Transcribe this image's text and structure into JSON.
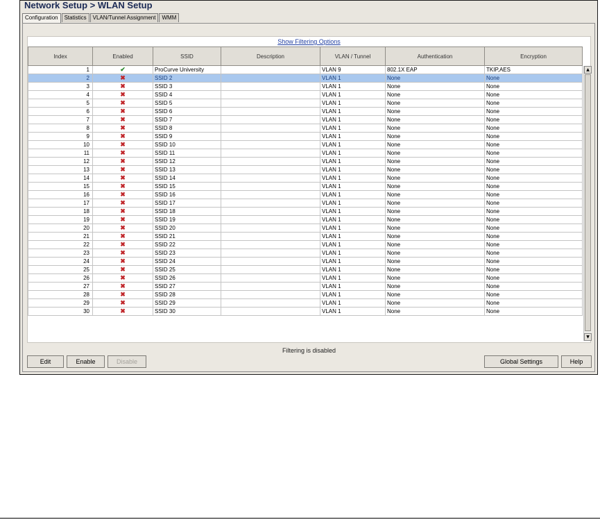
{
  "title": "Network Setup > WLAN Setup",
  "tabs": [
    "Configuration",
    "Statistics",
    "VLAN/Tunnel Assignment",
    "WMM"
  ],
  "filter_link": "Show Filtering Options",
  "filter_status": "Filtering is disabled",
  "columns": [
    "Index",
    "Enabled",
    "SSID",
    "Description",
    "VLAN / Tunnel",
    "Authentication",
    "Encryption"
  ],
  "icons": {
    "enabled": "check-icon",
    "disabled": "x-icon",
    "enabled_color": "#2e8b2e",
    "disabled_color": "#c0262a"
  },
  "selected_row_color": "#a9c8ee",
  "rows": [
    {
      "index": "1",
      "enabled": true,
      "ssid": "ProCurve University",
      "desc": "",
      "vlan": "VLAN 9",
      "auth": "802.1X EAP",
      "enc": "TKIP,AES"
    },
    {
      "index": "2",
      "enabled": false,
      "ssid": "SSID 2",
      "desc": "",
      "vlan": "VLAN 1",
      "auth": "None",
      "enc": "None",
      "selected": true
    },
    {
      "index": "3",
      "enabled": false,
      "ssid": "SSID 3",
      "desc": "",
      "vlan": "VLAN 1",
      "auth": "None",
      "enc": "None"
    },
    {
      "index": "4",
      "enabled": false,
      "ssid": "SSID 4",
      "desc": "",
      "vlan": "VLAN 1",
      "auth": "None",
      "enc": "None"
    },
    {
      "index": "5",
      "enabled": false,
      "ssid": "SSID 5",
      "desc": "",
      "vlan": "VLAN 1",
      "auth": "None",
      "enc": "None"
    },
    {
      "index": "6",
      "enabled": false,
      "ssid": "SSID 6",
      "desc": "",
      "vlan": "VLAN 1",
      "auth": "None",
      "enc": "None"
    },
    {
      "index": "7",
      "enabled": false,
      "ssid": "SSID 7",
      "desc": "",
      "vlan": "VLAN 1",
      "auth": "None",
      "enc": "None"
    },
    {
      "index": "8",
      "enabled": false,
      "ssid": "SSID 8",
      "desc": "",
      "vlan": "VLAN 1",
      "auth": "None",
      "enc": "None"
    },
    {
      "index": "9",
      "enabled": false,
      "ssid": "SSID 9",
      "desc": "",
      "vlan": "VLAN 1",
      "auth": "None",
      "enc": "None"
    },
    {
      "index": "10",
      "enabled": false,
      "ssid": "SSID 10",
      "desc": "",
      "vlan": "VLAN 1",
      "auth": "None",
      "enc": "None"
    },
    {
      "index": "11",
      "enabled": false,
      "ssid": "SSID 11",
      "desc": "",
      "vlan": "VLAN 1",
      "auth": "None",
      "enc": "None"
    },
    {
      "index": "12",
      "enabled": false,
      "ssid": "SSID 12",
      "desc": "",
      "vlan": "VLAN 1",
      "auth": "None",
      "enc": "None"
    },
    {
      "index": "13",
      "enabled": false,
      "ssid": "SSID 13",
      "desc": "",
      "vlan": "VLAN 1",
      "auth": "None",
      "enc": "None"
    },
    {
      "index": "14",
      "enabled": false,
      "ssid": "SSID 14",
      "desc": "",
      "vlan": "VLAN 1",
      "auth": "None",
      "enc": "None"
    },
    {
      "index": "15",
      "enabled": false,
      "ssid": "SSID 15",
      "desc": "",
      "vlan": "VLAN 1",
      "auth": "None",
      "enc": "None"
    },
    {
      "index": "16",
      "enabled": false,
      "ssid": "SSID 16",
      "desc": "",
      "vlan": "VLAN 1",
      "auth": "None",
      "enc": "None"
    },
    {
      "index": "17",
      "enabled": false,
      "ssid": "SSID 17",
      "desc": "",
      "vlan": "VLAN 1",
      "auth": "None",
      "enc": "None"
    },
    {
      "index": "18",
      "enabled": false,
      "ssid": "SSID 18",
      "desc": "",
      "vlan": "VLAN 1",
      "auth": "None",
      "enc": "None"
    },
    {
      "index": "19",
      "enabled": false,
      "ssid": "SSID 19",
      "desc": "",
      "vlan": "VLAN 1",
      "auth": "None",
      "enc": "None"
    },
    {
      "index": "20",
      "enabled": false,
      "ssid": "SSID 20",
      "desc": "",
      "vlan": "VLAN 1",
      "auth": "None",
      "enc": "None"
    },
    {
      "index": "21",
      "enabled": false,
      "ssid": "SSID 21",
      "desc": "",
      "vlan": "VLAN 1",
      "auth": "None",
      "enc": "None"
    },
    {
      "index": "22",
      "enabled": false,
      "ssid": "SSID 22",
      "desc": "",
      "vlan": "VLAN 1",
      "auth": "None",
      "enc": "None"
    },
    {
      "index": "23",
      "enabled": false,
      "ssid": "SSID 23",
      "desc": "",
      "vlan": "VLAN 1",
      "auth": "None",
      "enc": "None"
    },
    {
      "index": "24",
      "enabled": false,
      "ssid": "SSID 24",
      "desc": "",
      "vlan": "VLAN 1",
      "auth": "None",
      "enc": "None"
    },
    {
      "index": "25",
      "enabled": false,
      "ssid": "SSID 25",
      "desc": "",
      "vlan": "VLAN 1",
      "auth": "None",
      "enc": "None"
    },
    {
      "index": "26",
      "enabled": false,
      "ssid": "SSID 26",
      "desc": "",
      "vlan": "VLAN 1",
      "auth": "None",
      "enc": "None"
    },
    {
      "index": "27",
      "enabled": false,
      "ssid": "SSID 27",
      "desc": "",
      "vlan": "VLAN 1",
      "auth": "None",
      "enc": "None"
    },
    {
      "index": "28",
      "enabled": false,
      "ssid": "SSID 28",
      "desc": "",
      "vlan": "VLAN 1",
      "auth": "None",
      "enc": "None"
    },
    {
      "index": "29",
      "enabled": false,
      "ssid": "SSID 29",
      "desc": "",
      "vlan": "VLAN 1",
      "auth": "None",
      "enc": "None"
    },
    {
      "index": "30",
      "enabled": false,
      "ssid": "SSID 30",
      "desc": "",
      "vlan": "VLAN 1",
      "auth": "None",
      "enc": "None"
    }
  ],
  "buttons": {
    "edit": "Edit",
    "enable": "Enable",
    "disable": "Disable",
    "global_settings": "Global Settings",
    "help": "Help"
  },
  "disabled_buttons": [
    "disable"
  ]
}
